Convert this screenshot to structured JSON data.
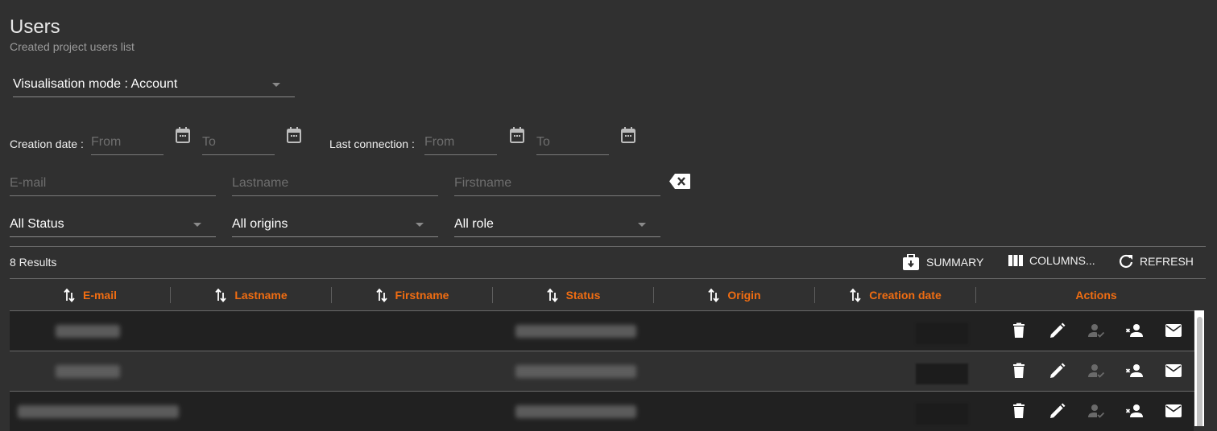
{
  "header": {
    "title": "Users",
    "subtitle": "Created project users list"
  },
  "visualisation_mode": {
    "value": "Visualisation mode : Account"
  },
  "date_filters": {
    "creation_label": "Creation date :",
    "last_connection_label": "Last connection :",
    "from_placeholder": "From",
    "to_placeholder": "To"
  },
  "text_filters": {
    "email_placeholder": "E-mail",
    "lastname_placeholder": "Lastname",
    "firstname_placeholder": "Firstname"
  },
  "select_filters": {
    "status": "All Status",
    "origins": "All origins",
    "role": "All role"
  },
  "toolbar": {
    "results": "8 Results",
    "summary_label": "SUMMARY",
    "columns_label": "COLUMNS...",
    "refresh_label": "REFRESH"
  },
  "table": {
    "columns": [
      "E-mail",
      "Lastname",
      "Firstname",
      "Status",
      "Origin",
      "Creation date",
      "Actions"
    ],
    "accent_color": "#f06d12",
    "rows": [
      {
        "email": "[redacted]",
        "lastname": "-",
        "firstname": "-",
        "status": "[redacted]",
        "origin": "-",
        "creation_date": "[redacted]"
      },
      {
        "email": "[redacted]",
        "lastname": "-",
        "firstname": "-",
        "status": "[redacted]",
        "origin": "-",
        "creation_date": "[redacted]"
      },
      {
        "email": "[redacted]",
        "lastname": "-",
        "firstname": "-",
        "status": "[redacted]",
        "origin": "-",
        "creation_date": "[redacted]"
      }
    ],
    "row_actions": [
      "delete-icon",
      "edit-icon",
      "validate-user-icon",
      "remove-user-icon",
      "email-icon"
    ]
  }
}
